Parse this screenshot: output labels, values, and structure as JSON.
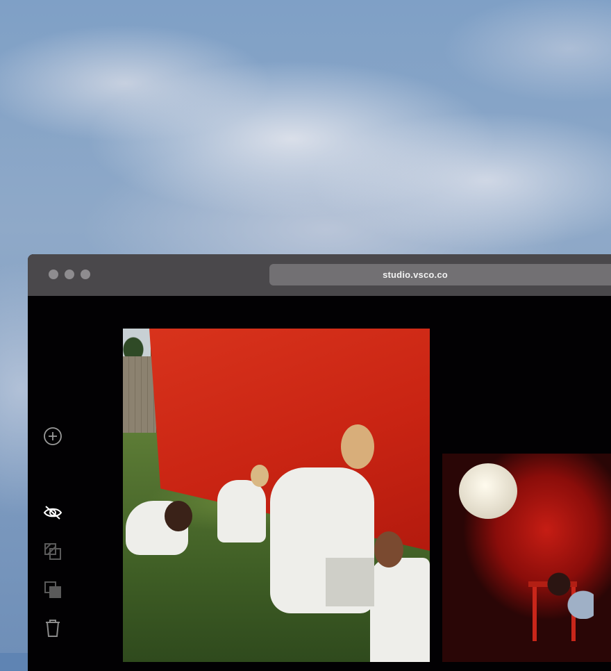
{
  "browser": {
    "url": "studio.vsco.co"
  },
  "toolbar": {
    "items": [
      {
        "icon": "add-circle-icon"
      },
      {
        "icon": "eye-off-icon"
      },
      {
        "icon": "layers-icon"
      },
      {
        "icon": "copy-icon"
      },
      {
        "icon": "trash-icon"
      }
    ]
  },
  "colors": {
    "titlebar": "#4a484b",
    "urlbar": "#727073",
    "content_bg": "#020103",
    "icon_active": "#ffffff",
    "icon_muted": "#5a5a5a"
  }
}
